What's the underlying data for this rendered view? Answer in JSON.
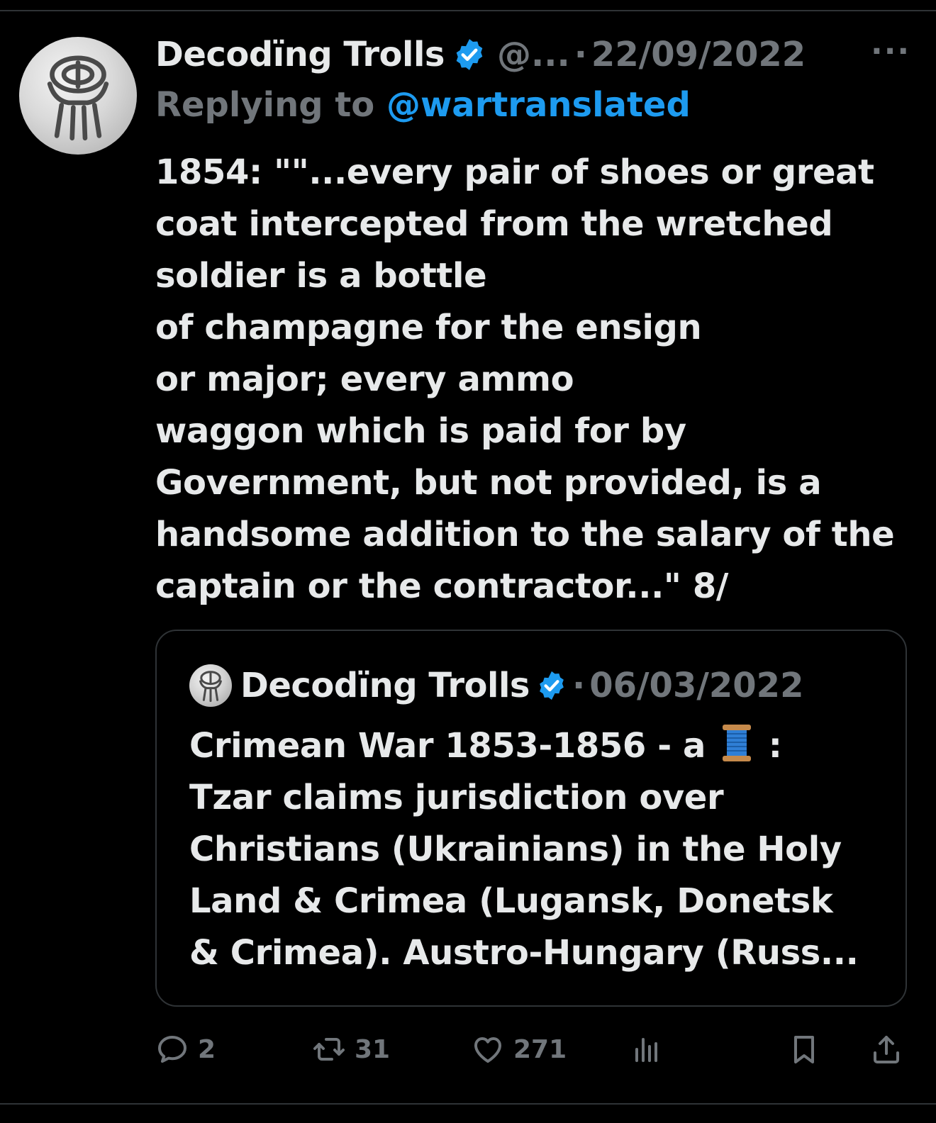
{
  "tweet": {
    "author_name": "Decodïng Trolls",
    "handle": "@...",
    "separator": "·",
    "date": "22/09/2022",
    "more_label": "···",
    "replying_prefix": "Replying to",
    "replying_handle": "@wartranslated",
    "text_lines": [
      "1854: \"\"...every pair of shoes or great",
      "coat intercepted from the wretched",
      "soldier is a bottle",
      "of champagne for the ensign",
      "or major; every ammo",
      "waggon which is paid for by",
      "Government, but not provided, is a",
      "handsome addition to the salary of the",
      "captain or the contractor...\" 8/"
    ]
  },
  "quote": {
    "author_name": "Decodïng Trolls",
    "separator": "·",
    "date": "06/03/2022",
    "line1_before": "Crimean War 1853-1856 - a",
    "line1_emoji": "spool-of-thread-icon",
    "line1_after": ":",
    "text_lines": [
      "Tzar claims jurisdiction over",
      "Christians (Ukrainians) in the Holy",
      "Land & Crimea (Lugansk, Donetsk",
      "& Crimea). Austro-Hungary (Russ..."
    ]
  },
  "actions": {
    "reply_count": "2",
    "retweet_count": "31",
    "like_count": "271",
    "icons": [
      "reply-icon",
      "retweet-icon",
      "like-icon",
      "views-icon",
      "bookmark-icon",
      "share-icon"
    ]
  },
  "colors": {
    "background": "#000000",
    "text": "#e7e9ea",
    "muted": "#71767b",
    "accent": "#1d9bf0",
    "border": "#2f3336"
  }
}
